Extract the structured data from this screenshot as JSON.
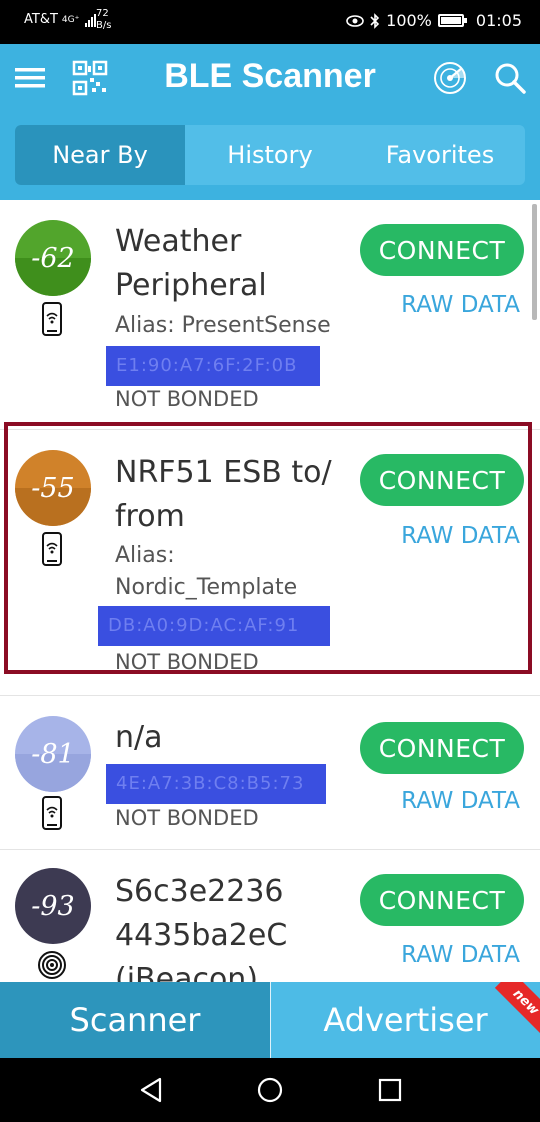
{
  "status_bar": {
    "carrier": "AT&T",
    "network": "4G⁺",
    "speed_value": "72",
    "speed_unit": "B/s",
    "battery": "100%",
    "time": "01:05"
  },
  "app_bar": {
    "title": "BLE Scanner",
    "menu_icon": "hamburger-menu-icon",
    "qr_icon": "qr-code-icon",
    "radar_icon": "radar-icon",
    "search_icon": "search-icon"
  },
  "tabs": [
    {
      "label": "Near By",
      "active": true
    },
    {
      "label": "History",
      "active": false
    },
    {
      "label": "Favorites",
      "active": false
    }
  ],
  "devices": [
    {
      "rssi": "-62",
      "rssi_color": "#52a52c",
      "name_lines": [
        "Weather",
        "Peripheral"
      ],
      "alias_lines": [
        "Alias: PresentSense"
      ],
      "address_redacted": "E1:90:A7:6F:2F:0B",
      "bond": "NOT BONDED",
      "device_icon": "smartphone-icon",
      "connect": "CONNECT",
      "raw": "RAW DATA"
    },
    {
      "rssi": "-55",
      "rssi_color": "#d0822a",
      "name_lines": [
        "NRF51 ESB to/",
        "from"
      ],
      "alias_lines": [
        "Alias:",
        "Nordic_Template"
      ],
      "address_redacted": "DB:A0:9D:AC:AF:91",
      "bond": "NOT BONDED",
      "device_icon": "smartphone-icon",
      "connect": "CONNECT",
      "raw": "RAW DATA"
    },
    {
      "rssi": "-81",
      "rssi_color": "#a7b4e8",
      "name_lines": [
        "n/a"
      ],
      "alias_lines": [],
      "address_redacted": "4E:A7:3B:C8:B5:73",
      "bond": "NOT BONDED",
      "device_icon": "smartphone-icon",
      "connect": "CONNECT",
      "raw": "RAW DATA"
    },
    {
      "rssi": "-93",
      "rssi_color": "#3d3a52",
      "name_lines": [
        "S6c3e2236",
        "4435ba2eC",
        "(iBeacon)"
      ],
      "alias_lines": [],
      "address_redacted": "",
      "bond": "",
      "device_icon": "beacon-icon",
      "connect": "CONNECT",
      "raw": "RAW DATA"
    }
  ],
  "bottom_nav": {
    "scanner": "Scanner",
    "advertiser": "Advertiser",
    "badge": "new"
  },
  "system_nav": {
    "back_icon": "back-triangle-icon",
    "home_icon": "home-circle-icon",
    "recents_icon": "recents-square-icon"
  },
  "colors": {
    "app_bar": "#3db2e0",
    "tab_active": "#2a93bc",
    "connect": "#28b964",
    "raw_data": "#3aa6dc",
    "highlight_border": "#8b0c24",
    "redaction": "#3a4fe0"
  }
}
